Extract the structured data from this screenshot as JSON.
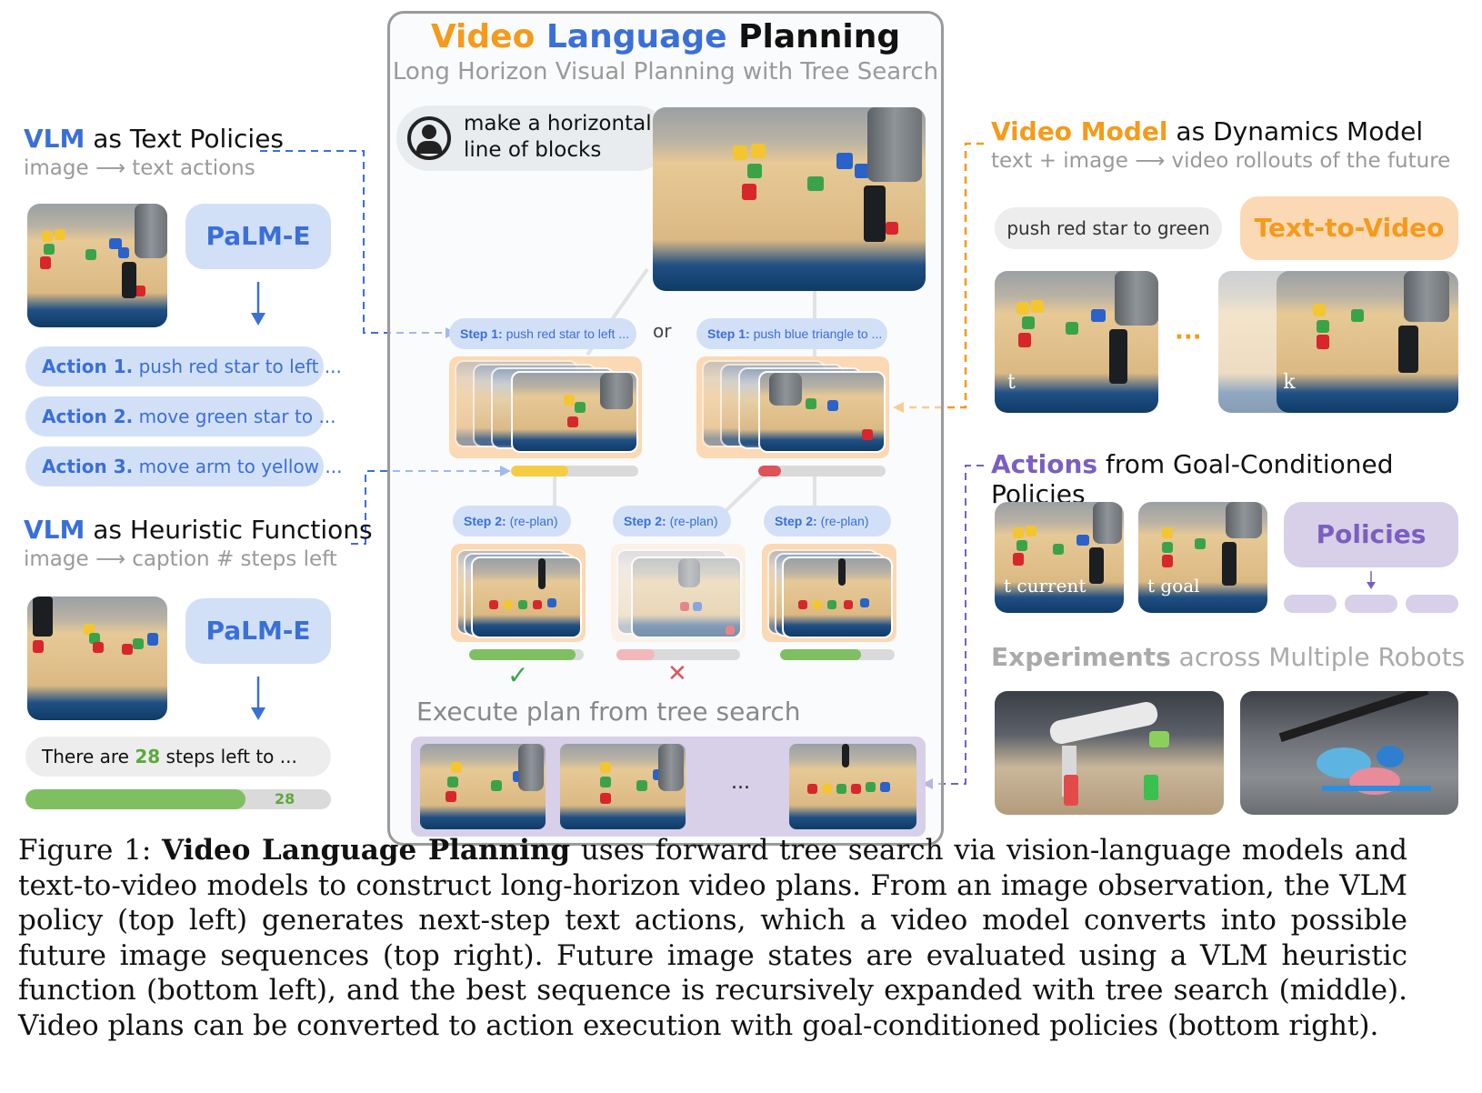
{
  "center": {
    "title_word1": "Video",
    "title_word2": "Language",
    "title_word3": "Planning",
    "subtitle": "Long Horizon Visual Planning with Tree Search",
    "prompt": "make a horizontal line of blocks",
    "or_label": "or",
    "step1_left_bold": "Step 1:",
    "step1_left_text": " push red star to left ...",
    "step1_right_bold": "Step 1:",
    "step1_right_text": " push blue triangle to ...",
    "step2_bold": "Step 2:",
    "step2_text": " (re-plan)",
    "check_mark": "✓",
    "cross_mark": "✕",
    "execute_label": "Execute plan from tree search",
    "ellipsis": "...",
    "heuristic_levels": {
      "step1_left": 0.45,
      "step1_right": 0.18,
      "step2_a": 0.93,
      "step2_b": 0.31,
      "step2_c": 0.71
    }
  },
  "left_top": {
    "title_bold": "VLM",
    "title_rest": " as Text Policies",
    "subtitle": "image ⟶ text actions",
    "model": "PaLM-E",
    "actions": [
      {
        "bold": "Action 1.",
        "text": " push red star to left ..."
      },
      {
        "bold": "Action 2.",
        "text": " move green star to ..."
      },
      {
        "bold": "Action 3.",
        "text": " move arm to yellow ..."
      }
    ]
  },
  "left_bottom": {
    "title_bold": "VLM",
    "title_rest": " as Heuristic Functions",
    "subtitle": "image ⟶ caption # steps left",
    "model": "PaLM-E",
    "caption_pre": "There are ",
    "caption_num": "28",
    "caption_post": " steps left to ...",
    "bar_value": "28",
    "bar_fraction": 0.72
  },
  "right_top": {
    "title_colored": "Video Model",
    "title_rest": " as Dynamics Model",
    "subtitle": "text + image ⟶ video rollouts of the future",
    "prompt": "push red star to green",
    "model": "Text-to-Video",
    "frame_t": "t",
    "frame_tk": "t + k",
    "dots": "···"
  },
  "right_mid": {
    "title_colored": "Actions",
    "title_rest": " from Goal-Conditioned Policies",
    "frame_current": "t current",
    "frame_goal": "t goal",
    "model": "Policies"
  },
  "right_bottom": {
    "title_bold": "Experiments",
    "title_rest": " across Multiple Robots"
  },
  "caption": {
    "prefix": "Figure 1: ",
    "bold": "Video Language Planning",
    "text": " uses forward tree search via vision-language models and text-to-video models to construct long-horizon video plans. From an image observation, the VLM policy (top left) generates next-step text actions, which a video model converts into possible future image sequences (top right). Future image states are evaluated using a VLM heuristic function (bottom left), and the best sequence is recursively expanded with tree search (middle). Video plans can be converted to action execution with goal-conditioned policies (bottom right)."
  },
  "colors": {
    "blue": "#3a6fd8",
    "orange": "#f59a1b",
    "purple": "#7b5fbf",
    "green_bar": "#7fbf62",
    "yellow_bar": "#f5cd45",
    "red_bar": "#e0525a",
    "pink_bar": "#f3b8bc"
  }
}
